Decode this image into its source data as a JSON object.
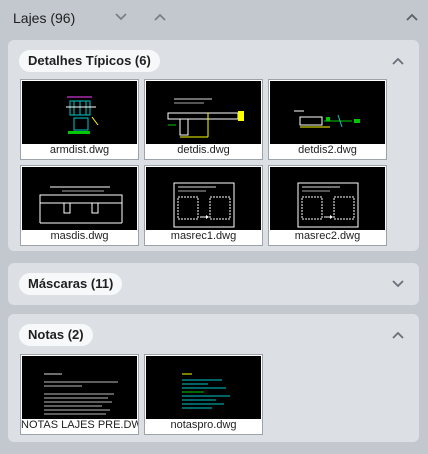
{
  "header": {
    "title": "Lajes (96)"
  },
  "sections": [
    {
      "title": "Detalhes Típicos (6)",
      "expanded": true,
      "items": [
        {
          "label": "armdist.dwg"
        },
        {
          "label": "detdis.dwg"
        },
        {
          "label": "detdis2.dwg"
        },
        {
          "label": "masdis.dwg"
        },
        {
          "label": "masrec1.dwg"
        },
        {
          "label": "masrec2.dwg"
        }
      ]
    },
    {
      "title": "Máscaras (11)",
      "expanded": false,
      "items": []
    },
    {
      "title": "Notas (2)",
      "expanded": true,
      "items": [
        {
          "label": "NOTAS LAJES PRE.DWG"
        },
        {
          "label": "notaspro.dwg"
        }
      ]
    }
  ],
  "colors": {
    "background": "#c3c8ce",
    "panel": "#dce0e5",
    "pill": "#f7f8fa",
    "thumb_bg": "#000000"
  },
  "icons": {
    "header_chevron_down": "chevron-down-icon",
    "header_chevron_up": "chevron-up-icon",
    "header_collapse": "chevron-up-icon"
  }
}
